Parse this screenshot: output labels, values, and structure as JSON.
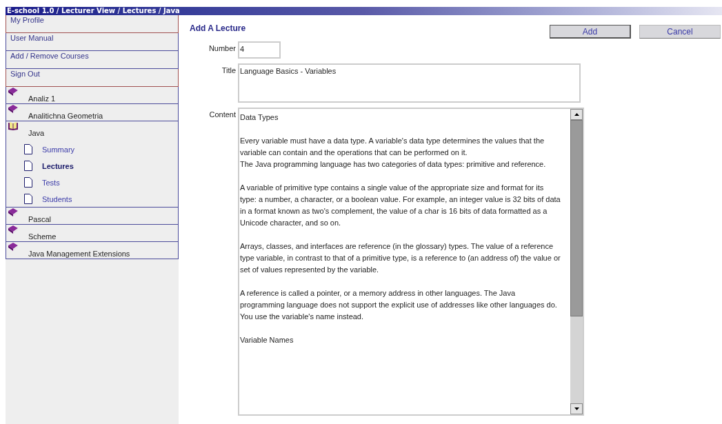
{
  "breadcrumb": "E-school 1.0 / Lecturer View / Lectures / Java",
  "sidebar": {
    "links": [
      {
        "label": "My Profile",
        "color": "#a05050"
      },
      {
        "label": "User Manual",
        "color": "#4a4a9a"
      },
      {
        "label": "Add / Remove Courses",
        "color": "#4a4a9a"
      },
      {
        "label": "Sign Out",
        "color": "#a05050"
      }
    ],
    "courses": [
      {
        "label": "Analiz 1",
        "expanded": false
      },
      {
        "label": "Analitichna Geometria",
        "expanded": false
      },
      {
        "label": "Java",
        "expanded": true,
        "children": [
          {
            "label": "Summary",
            "selected": false
          },
          {
            "label": "Lectures",
            "selected": true
          },
          {
            "label": "Tests",
            "selected": false
          },
          {
            "label": "Students",
            "selected": false
          }
        ]
      },
      {
        "label": "Pascal",
        "expanded": false
      },
      {
        "label": "Scheme",
        "expanded": false
      },
      {
        "label": "Java Management Extensions",
        "expanded": false
      }
    ]
  },
  "form": {
    "heading": "Add A Lecture",
    "buttons": [
      "Add",
      "Cancel"
    ],
    "number": {
      "label": "Number",
      "value": "4"
    },
    "title": {
      "label": "Title",
      "value": "Language Basics - Variables"
    },
    "content": {
      "label": "Content",
      "blocks": [
        [
          "Data Types"
        ],
        [
          "Every variable must have a data type. A variable's data type determines the values that the variable can contain and the operations that can be performed on it.",
          "The Java programming language has two categories of data types: primitive and reference."
        ],
        [
          "A variable of primitive type contains a single value of the appropriate size and format for its type: a number, a character, or a boolean value. For example, an integer value is 32 bits of data in a format known as two's complement, the value of a char is 16 bits of data formatted as a Unicode character, and so on."
        ],
        [
          "Arrays, classes, and interfaces are reference (in the glossary) types. The value of a reference type variable, in contrast to that of a primitive type, is a reference to (an address of) the value or set of values represented by the variable."
        ],
        [
          "A reference is called a pointer, or a memory address in other languages. The Java programming language does not support the explicit use of addresses like other languages do. You use the variable's name instead."
        ],
        [
          "Variable Names"
        ]
      ]
    }
  }
}
